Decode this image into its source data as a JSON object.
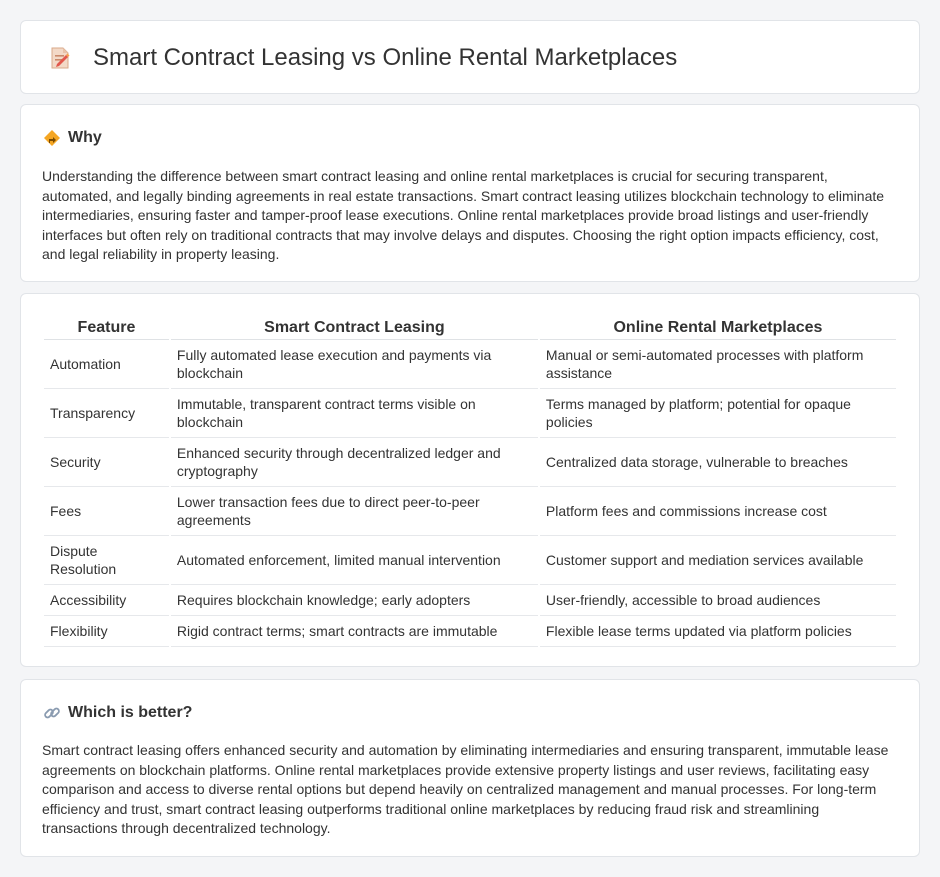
{
  "header": {
    "title": "Smart Contract Leasing vs Online Rental Marketplaces",
    "icon": "document-pencil-icon"
  },
  "why": {
    "title": "Why",
    "icon": "diamond-direction-icon",
    "text": "Understanding the difference between smart contract leasing and online rental marketplaces is crucial for securing transparent, automated, and legally binding agreements in real estate transactions. Smart contract leasing utilizes blockchain technology to eliminate intermediaries, ensuring faster and tamper-proof lease executions. Online rental marketplaces provide broad listings and user-friendly interfaces but often rely on traditional contracts that may involve delays and disputes. Choosing the right option impacts efficiency, cost, and legal reliability in property leasing."
  },
  "table": {
    "headers": [
      "Feature",
      "Smart Contract Leasing",
      "Online Rental Marketplaces"
    ],
    "rows": [
      [
        "Automation",
        "Fully automated lease execution and payments via blockchain",
        "Manual or semi-automated processes with platform assistance"
      ],
      [
        "Transparency",
        "Immutable, transparent contract terms visible on blockchain",
        "Terms managed by platform; potential for opaque policies"
      ],
      [
        "Security",
        "Enhanced security through decentralized ledger and cryptography",
        "Centralized data storage, vulnerable to breaches"
      ],
      [
        "Fees",
        "Lower transaction fees due to direct peer-to-peer agreements",
        "Platform fees and commissions increase cost"
      ],
      [
        "Dispute Resolution",
        "Automated enforcement, limited manual intervention",
        "Customer support and mediation services available"
      ],
      [
        "Accessibility",
        "Requires blockchain knowledge; early adopters",
        "User-friendly, accessible to broad audiences"
      ],
      [
        "Flexibility",
        "Rigid contract terms; smart contracts are immutable",
        "Flexible lease terms updated via platform policies"
      ]
    ]
  },
  "better": {
    "title": "Which is better?",
    "icon": "link-icon",
    "text": "Smart contract leasing offers enhanced security and automation by eliminating intermediaries and ensuring transparent, immutable lease agreements on blockchain platforms. Online rental marketplaces provide extensive property listings and user reviews, facilitating easy comparison and access to diverse rental options but depend heavily on centralized management and manual processes. For long-term efficiency and trust, smart contract leasing outperforms traditional online marketplaces by reducing fraud risk and streamlining transactions through decentralized technology."
  }
}
